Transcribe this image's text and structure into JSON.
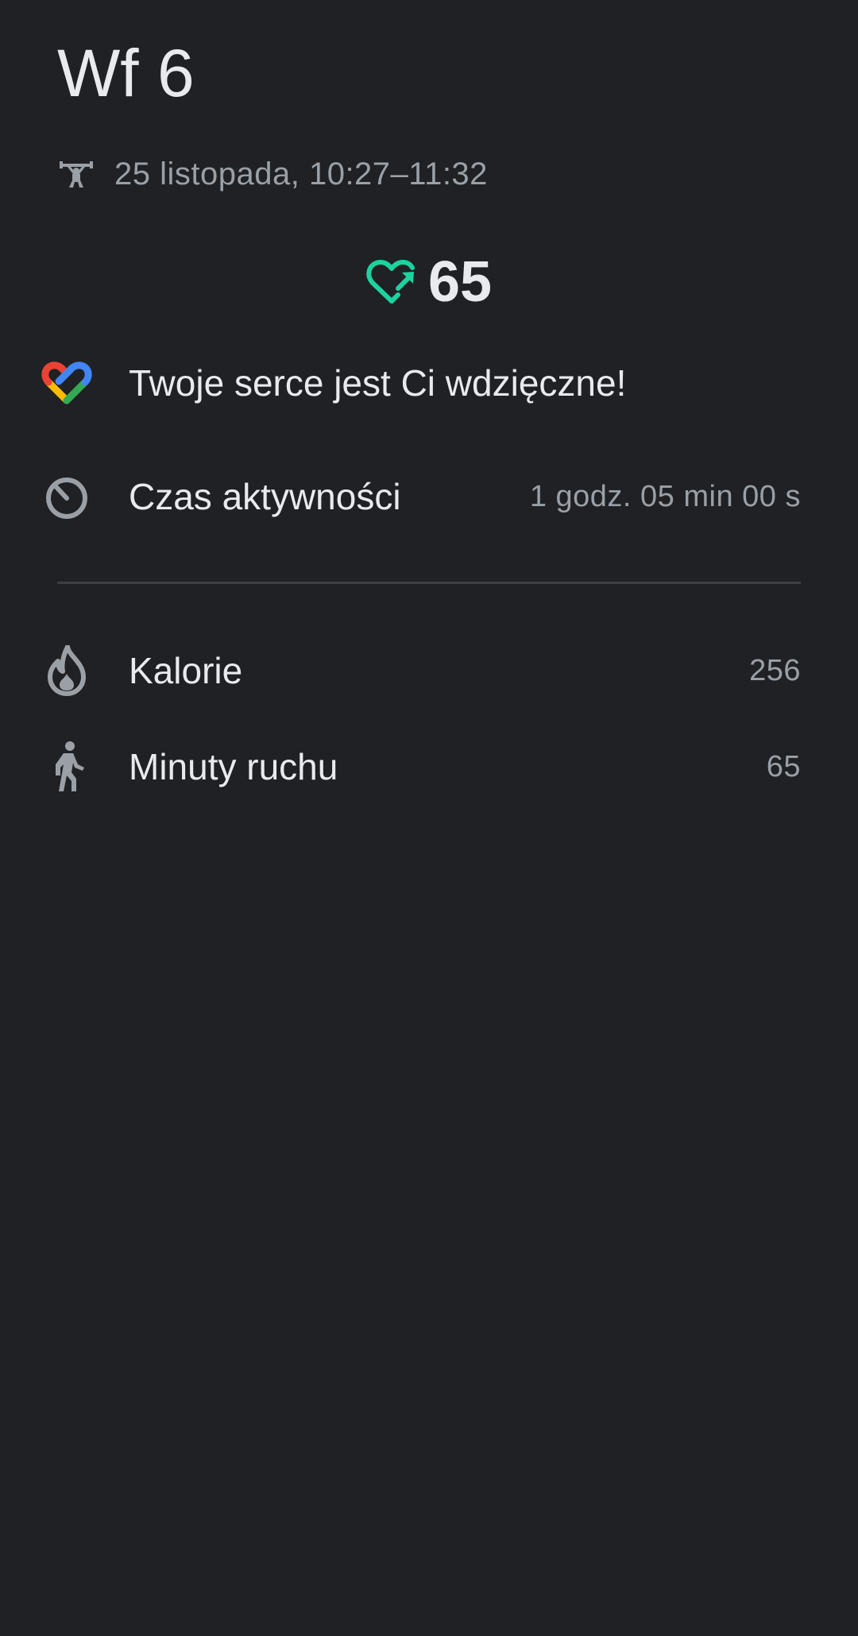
{
  "header": {
    "title": "Wf 6",
    "date_range": "25 listopada, 10:27–11:32",
    "activity_icon": "weightlifting-icon"
  },
  "heart_points": {
    "icon": "heart-points-icon",
    "value": "65",
    "color": "#1ed2a0"
  },
  "message": {
    "icon": "google-fit-logo",
    "text": "Twoje serce jest Ci wdzięczne!"
  },
  "active_time": {
    "icon": "timer-icon",
    "label": "Czas aktywności",
    "value": "1 godz. 05 min 00 s"
  },
  "stats": [
    {
      "icon": "flame-icon",
      "label": "Kalorie",
      "value": "256"
    },
    {
      "icon": "walking-icon",
      "label": "Minuty ruchu",
      "value": "65"
    }
  ],
  "colors": {
    "background": "#202124",
    "primary_text": "#e8eaed",
    "secondary_text": "#9aa0a6",
    "icon_gray": "#9aa0a6",
    "accent": "#1ed2a0"
  }
}
